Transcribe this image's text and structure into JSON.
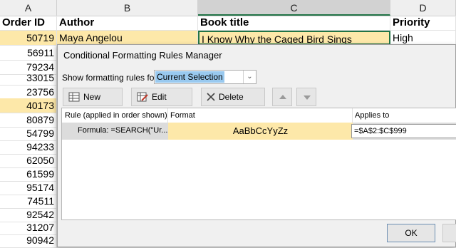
{
  "columns": [
    "A",
    "B",
    "C",
    "D"
  ],
  "sheet": {
    "header": {
      "order_id": "Order ID",
      "author": "Author",
      "book_title": "Book title",
      "priority": "Priority"
    },
    "first_row": {
      "order_id": "50719",
      "author": "Maya Angelou",
      "book_title": "I Know Why the Caged Bird Sings",
      "priority": "High"
    },
    "order_ids": [
      "56911",
      "79234",
      "33015",
      "23756",
      "40173",
      "80879",
      "54799",
      "94233",
      "62050",
      "61599",
      "95174",
      "74511",
      "92542",
      "31207",
      "90942"
    ],
    "highlight_color": "#fde8a9"
  },
  "dialog": {
    "title": "Conditional Formatting Rules Manager",
    "show_label": "Show formatting rules for:",
    "show_value": "Current Selection",
    "new_rule": "New Rule...",
    "edit_rule": "Edit Rule...",
    "delete_rule": "Delete Rule",
    "col_rule": "Rule (applied in order shown)",
    "col_format": "Format",
    "col_applies": "Applies to",
    "rule": {
      "text": "Formula: =SEARCH(\"Ur...",
      "format_preview": "AaBbCcYyZz",
      "applies_to": "=$A$2:$C$999"
    },
    "ok": "OK"
  }
}
